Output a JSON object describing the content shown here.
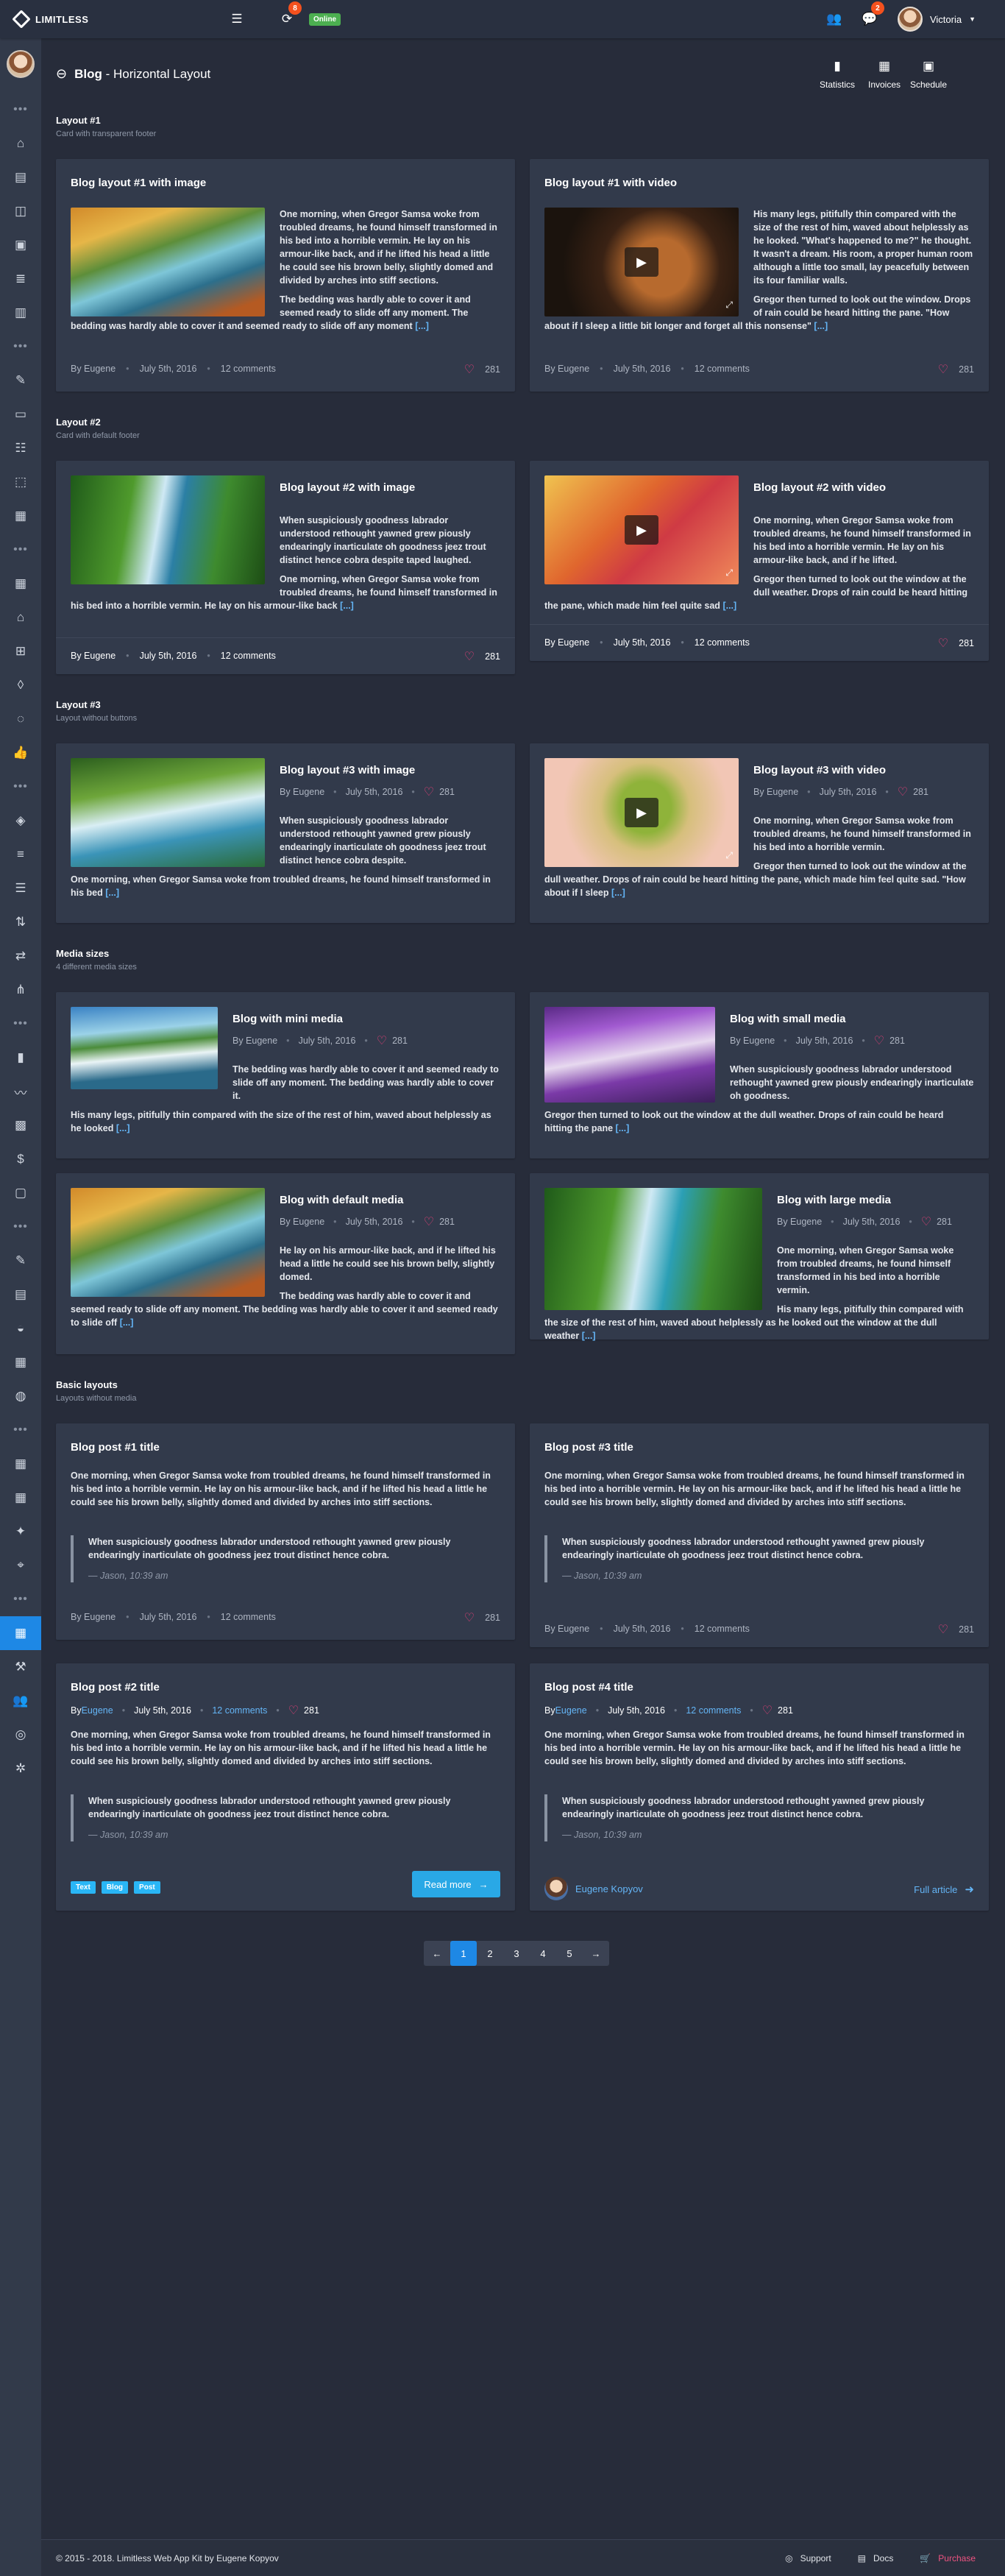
{
  "topbar": {
    "brand": "LIMITLESS",
    "badge_count": "8",
    "status": "Online",
    "messages_badge": "2",
    "username": "Victoria"
  },
  "header": {
    "title_bold": "Blog",
    "title_rest": " - Horizontal Layout",
    "buttons": [
      "Statistics",
      "Invoices",
      "Schedule"
    ]
  },
  "sections": [
    {
      "title": "Layout #1",
      "subtitle": "Card with transparent footer"
    },
    {
      "title": "Layout #2",
      "subtitle": "Card with default footer"
    },
    {
      "title": "Layout #3",
      "subtitle": "Layout without buttons"
    },
    {
      "title": "Media sizes",
      "subtitle": "4 different media sizes"
    },
    {
      "title": "Basic layouts",
      "subtitle": "Layouts without media"
    }
  ],
  "cards": {
    "l1a": {
      "title": "Blog layout #1 with image",
      "p1": "One morning, when Gregor Samsa woke from troubled dreams, he found himself transformed in his bed into a horrible vermin. He lay on his armour-like back, and if he lifted his head a little he could see his brown belly, slightly domed and divided by arches into stiff sections.",
      "p2": "The bedding was hardly able to cover it and seemed ready to slide off any moment. The bedding was hardly able to cover it and seemed ready to slide off any moment",
      "author": "By Eugene",
      "date": "July 5th, 2016",
      "comments": "12 comments",
      "likes": "281"
    },
    "l1b": {
      "title": "Blog layout #1 with video",
      "p1": "His many legs, pitifully thin compared with the size of the rest of him, waved about helplessly as he looked. \"What's happened to me?\" he thought. It wasn't a dream. His room, a proper human room although a little too small, lay peacefully between its four familiar walls.",
      "p2": "Gregor then turned to look out the window. Drops of rain could be heard hitting the pane. \"How about if I sleep a little bit longer and forget all this nonsense\"",
      "author": "By Eugene",
      "date": "July 5th, 2016",
      "comments": "12 comments",
      "likes": "281"
    },
    "l2a": {
      "title": "Blog layout #2 with image",
      "p1": "When suspiciously goodness labrador understood rethought yawned grew piously endearingly inarticulate oh goodness jeez trout distinct hence cobra despite taped laughed.",
      "p2": "One morning, when Gregor Samsa woke from troubled dreams, he found himself transformed in his bed into a horrible vermin. He lay on his armour-like back",
      "author": "By Eugene",
      "date": "July 5th, 2016",
      "comments": "12 comments",
      "likes": "281"
    },
    "l2b": {
      "title": "Blog layout #2 with video",
      "p1": "One morning, when Gregor Samsa woke from troubled dreams, he found himself transformed in his bed into a horrible vermin. He lay on his armour-like back, and if he lifted.",
      "p2": "Gregor then turned to look out the window at the dull weather. Drops of rain could be heard hitting the pane, which made him feel quite sad",
      "author": "By Eugene",
      "date": "July 5th, 2016",
      "comments": "12 comments",
      "likes": "281"
    },
    "l3a": {
      "title": "Blog layout #3 with image",
      "author": "By Eugene",
      "date": "July 5th, 2016",
      "likes": "281",
      "p1": "When suspiciously goodness labrador understood rethought yawned grew piously endearingly inarticulate oh goodness jeez trout distinct hence cobra despite.",
      "p2": "One morning, when Gregor Samsa woke from troubled dreams, he found himself transformed in his bed"
    },
    "l3b": {
      "title": "Blog layout #3 with video",
      "author": "By Eugene",
      "date": "July 5th, 2016",
      "likes": "281",
      "p1": "One morning, when Gregor Samsa woke from troubled dreams, he found himself transformed in his bed into a horrible vermin.",
      "p2": "Gregor then turned to look out the window at the dull weather. Drops of rain could be heard hitting the pane, which made him feel quite sad. \"How about if I sleep"
    },
    "m1": {
      "title": "Blog with mini media",
      "author": "By Eugene",
      "date": "July 5th, 2016",
      "likes": "281",
      "p1": "The bedding was hardly able to cover it and seemed ready to slide off any moment. The bedding was hardly able to cover it.",
      "p2": "His many legs, pitifully thin compared with the size of the rest of him, waved about helplessly as he looked"
    },
    "m2": {
      "title": "Blog with small media",
      "author": "By Eugene",
      "date": "July 5th, 2016",
      "likes": "281",
      "p1": "When suspiciously goodness labrador understood rethought yawned grew piously endearingly inarticulate oh goodness.",
      "p2": "Gregor then turned to look out the window at the dull weather. Drops of rain could be heard hitting the pane"
    },
    "m3": {
      "title": "Blog with default media",
      "author": "By Eugene",
      "date": "July 5th, 2016",
      "likes": "281",
      "p1": "He lay on his armour-like back, and if he lifted his head a little he could see his brown belly, slightly domed.",
      "p2": "The bedding was hardly able to cover it and seemed ready to slide off any moment. The bedding was hardly able to cover it and seemed ready to slide off"
    },
    "m4": {
      "title": "Blog with large media",
      "author": "By Eugene",
      "date": "July 5th, 2016",
      "likes": "281",
      "p1": "One morning, when Gregor Samsa woke from troubled dreams, he found himself transformed in his bed into a horrible vermin.",
      "p2": "His many legs, pitifully thin compared with the size of the rest of him, waved about helplessly as he looked out the window at the dull weather"
    },
    "b1": {
      "title": "Blog post #1 title",
      "p1": "One morning, when Gregor Samsa woke from troubled dreams, he found himself transformed in his bed into a horrible vermin. He lay on his armour-like back, and if he lifted his head a little he could see his brown belly, slightly domed and divided by arches into stiff sections.",
      "quote": "When suspiciously goodness labrador understood rethought yawned grew piously endearingly inarticulate oh goodness jeez trout distinct hence cobra.",
      "quote_src": "— Jason, 10:39 am",
      "author": "By Eugene",
      "date": "July 5th, 2016",
      "comments": "12 comments",
      "likes": "281"
    },
    "b3": {
      "title": "Blog post #3 title",
      "p1": "One morning, when Gregor Samsa woke from troubled dreams, he found himself transformed in his bed into a horrible vermin. He lay on his armour-like back, and if he lifted his head a little he could see his brown belly, slightly domed and divided by arches into stiff sections.",
      "quote": "When suspiciously goodness labrador understood rethought yawned grew piously endearingly inarticulate oh goodness jeez trout distinct hence cobra.",
      "quote_src": "— Jason, 10:39 am",
      "author": "By Eugene",
      "date": "July 5th, 2016",
      "comments": "12 comments",
      "likes": "281"
    },
    "b2": {
      "title": "Blog post #2 title",
      "by": "By ",
      "author": "Eugene",
      "date": "July 5th, 2016",
      "comments": "12 comments",
      "likes": "281",
      "p1": "One morning, when Gregor Samsa woke from troubled dreams, he found himself transformed in his bed into a horrible vermin. He lay on his armour-like back, and if he lifted his head a little he could see his brown belly, slightly domed and divided by arches into stiff sections.",
      "quote": "When suspiciously goodness labrador understood rethought yawned grew piously endearingly inarticulate oh goodness jeez trout distinct hence cobra.",
      "quote_src": "— Jason, 10:39 am",
      "tags": [
        "Text",
        "Blog",
        "Post"
      ],
      "read_more": "Read more"
    },
    "b4": {
      "title": "Blog post #4 title",
      "by": "By ",
      "author": "Eugene",
      "date": "July 5th, 2016",
      "comments": "12 comments",
      "likes": "281",
      "p1": "One morning, when Gregor Samsa woke from troubled dreams, he found himself transformed in his bed into a horrible vermin. He lay on his armour-like back, and if he lifted his head a little he could see his brown belly, slightly domed and divided by arches into stiff sections.",
      "quote": "When suspiciously goodness labrador understood rethought yawned grew piously endearingly inarticulate oh goodness jeez trout distinct hence cobra.",
      "quote_src": "— Jason, 10:39 am",
      "author_name": "Eugene Kopyov",
      "full_article": "Full article"
    }
  },
  "more": "[...]",
  "pagination": {
    "pages": [
      "1",
      "2",
      "3",
      "4",
      "5"
    ],
    "current": "1"
  },
  "footer": {
    "copyright": "© 2015 - 2018. Limitless Web App Kit by Eugene Kopyov",
    "support": "Support",
    "docs": "Docs",
    "purchase": "Purchase"
  }
}
